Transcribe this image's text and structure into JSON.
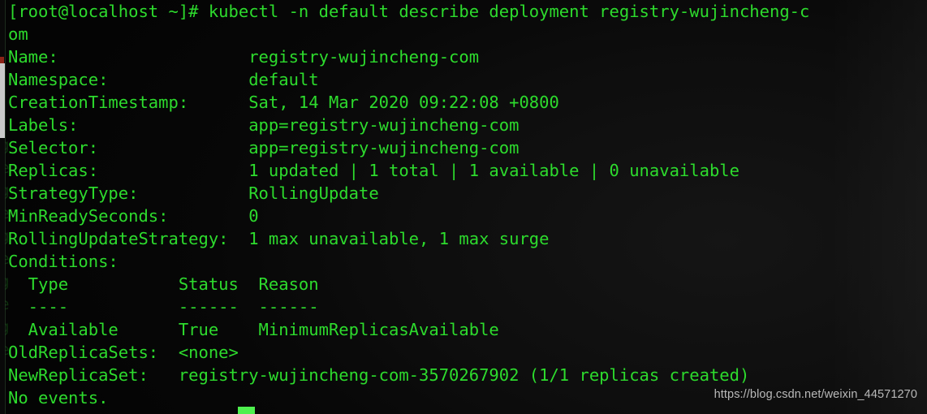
{
  "terminal": {
    "prompt_artifact": "[",
    "lines": [
      "[root@localhost ~]# kubectl -n default describe deployment registry-wujincheng-c",
      "om",
      "Name:                   registry-wujincheng-com",
      "Namespace:              default",
      "CreationTimestamp:      Sat, 14 Mar 2020 09:22:08 +0800",
      "Labels:                 app=registry-wujincheng-com",
      "Selector:               app=registry-wujincheng-com",
      "Replicas:               1 updated | 1 total | 1 available | 0 unavailable",
      "StrategyType:           RollingUpdate",
      "MinReadySeconds:        0",
      "RollingUpdateStrategy:  1 max unavailable, 1 max surge",
      "Conditions:",
      "  Type           Status  Reason",
      "  ----           ------  ------",
      "  Available      True    MinimumReplicasAvailable",
      "OldReplicaSets:  <none>",
      "NewReplicaSet:   registry-wujincheng-com-3570267902 (1/1 replicas created)",
      "No events."
    ],
    "ghost_artifact_lines": [
      "g",
      "e",
      "g",
      "e",
      "g",
      "e",
      "g",
      "e",
      "g",
      "e"
    ],
    "cursor": "block",
    "colors": {
      "foreground": "#2ddb2d",
      "background": "#060606",
      "cursor": "#4ef04e",
      "watermark": "#b9b9b9",
      "scrollbar_thumb": "#c9c9c9"
    }
  },
  "watermark": {
    "text": "https://blog.csdn.net/weixin_44571270"
  }
}
